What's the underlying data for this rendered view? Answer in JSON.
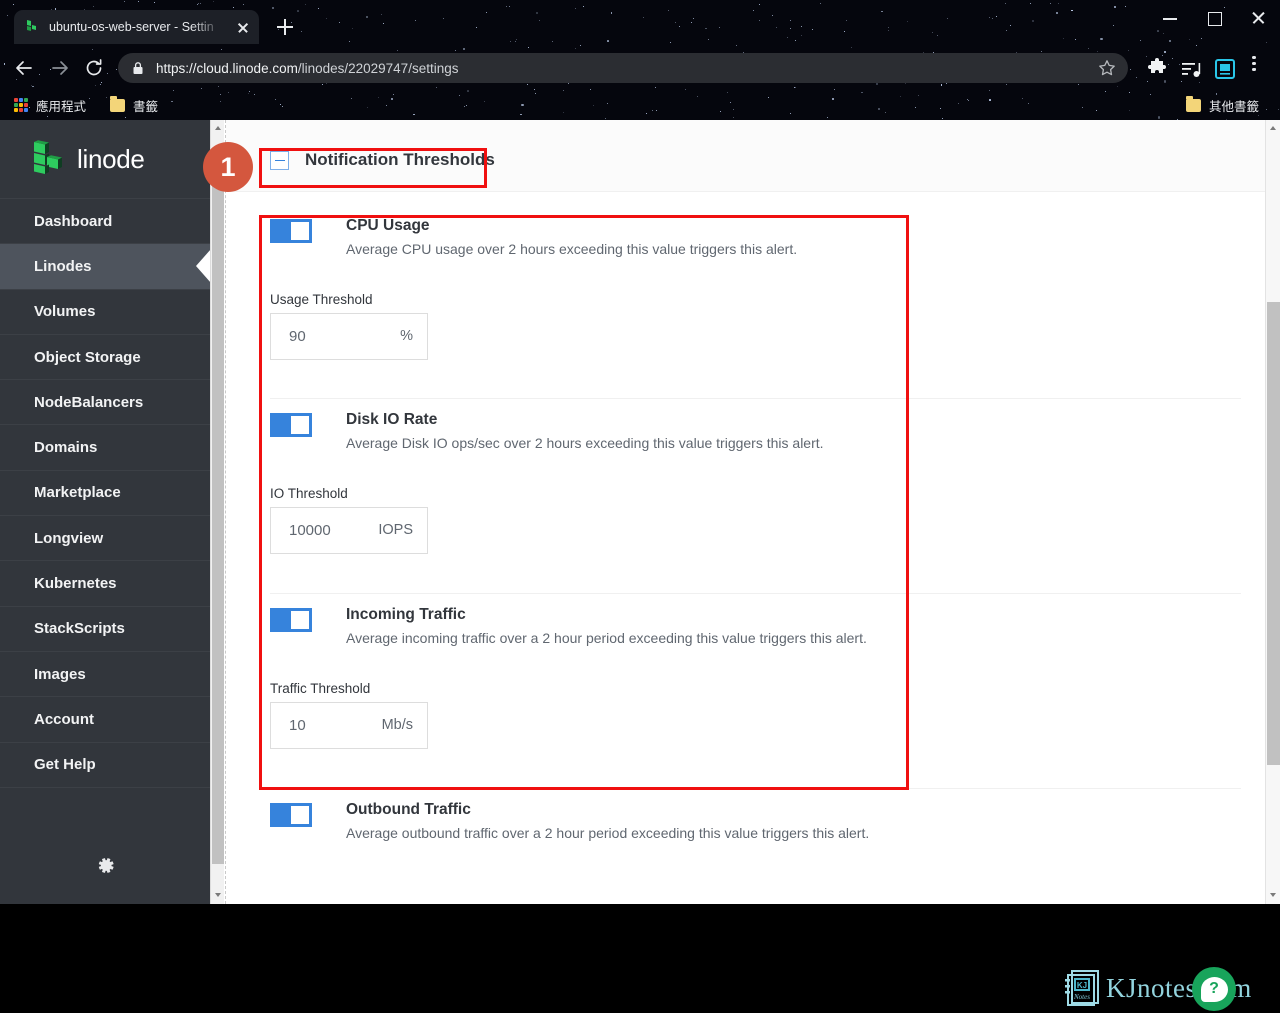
{
  "browser": {
    "tab": {
      "title": "ubuntu-os-web-server - Settin",
      "favicon": "ubuntu-linode-favicon",
      "close_icon": "close-icon"
    },
    "new_tab_icon": "plus-icon",
    "window_controls": {
      "minimize": "minimize-icon",
      "maximize": "maximize-icon",
      "close": "close-icon"
    },
    "nav": {
      "back_icon": "back-arrow-icon",
      "forward_icon": "forward-arrow-icon",
      "reload_icon": "reload-icon"
    },
    "omnibox": {
      "lock_icon": "lock-icon",
      "url_prefix": "https://cloud.linode.com",
      "url_path": "/linodes/22029747/settings",
      "full_url": "https://cloud.linode.com/linodes/22029747/settings",
      "star_icon": "star-bookmark-icon"
    },
    "toolbar_icons": [
      "extensions-puzzle-icon",
      "reading-list-icon",
      "profile-icon",
      "three-dot-menu-icon"
    ],
    "bookmarks": [
      {
        "label": "應用程式",
        "icon": "apps-grid-icon"
      },
      {
        "label": "書籤",
        "icon": "folder-icon"
      },
      {
        "label": "其他書籤",
        "icon": "folder-icon"
      }
    ]
  },
  "sidebar": {
    "logo": {
      "text": "linode",
      "icon": "linode-blocks-logo"
    },
    "items": [
      {
        "label": "Dashboard",
        "active": false
      },
      {
        "label": "Linodes",
        "active": true
      },
      {
        "label": "Volumes",
        "active": false
      },
      {
        "label": "Object Storage",
        "active": false
      },
      {
        "label": "NodeBalancers",
        "active": false
      },
      {
        "label": "Domains",
        "active": false
      },
      {
        "label": "Marketplace",
        "active": false
      },
      {
        "label": "Longview",
        "active": false
      },
      {
        "label": "Kubernetes",
        "active": false
      },
      {
        "label": "StackScripts",
        "active": false
      },
      {
        "label": "Images",
        "active": false
      },
      {
        "label": "Account",
        "active": false
      },
      {
        "label": "Get Help",
        "active": false
      }
    ],
    "settings_icon": "gear-icon"
  },
  "panel": {
    "title": "Notification Thresholds",
    "collapse_icon": "minus-collapse-icon",
    "alerts": [
      {
        "name": "CPU Usage",
        "description": "Average CPU usage over 2 hours exceeding this value triggers this alert.",
        "enabled": true,
        "field_label": "Usage Threshold",
        "value": "90",
        "unit": "%"
      },
      {
        "name": "Disk IO Rate",
        "description": "Average Disk IO ops/sec over 2 hours exceeding this value triggers this alert.",
        "enabled": true,
        "field_label": "IO Threshold",
        "value": "10000",
        "unit": "IOPS"
      },
      {
        "name": "Incoming Traffic",
        "description": "Average incoming traffic over a 2 hour period exceeding this value triggers this alert.",
        "enabled": true,
        "field_label": "Traffic Threshold",
        "value": "10",
        "unit": "Mb/s"
      },
      {
        "name": "Outbound Traffic",
        "description": "Average outbound traffic over a 2 hour period exceeding this value triggers this alert.",
        "enabled": true,
        "field_label": "",
        "value": "",
        "unit": ""
      }
    ]
  },
  "annotations": {
    "badge_number": "1",
    "highlight_color": "#f01010",
    "badge_color": "#d4573e"
  },
  "watermark": {
    "text": "KJnotes.com",
    "logo_text": "KJ",
    "logo_sub": "Notes",
    "color": "#93d4de"
  },
  "help_button": {
    "icon": "question-mark-help-icon",
    "label": "?"
  },
  "colors": {
    "sidebar_bg": "#32363c",
    "sidebar_active": "#4e545d",
    "accent_blue": "#3683dc",
    "logo_green": "#2ecc5f"
  }
}
